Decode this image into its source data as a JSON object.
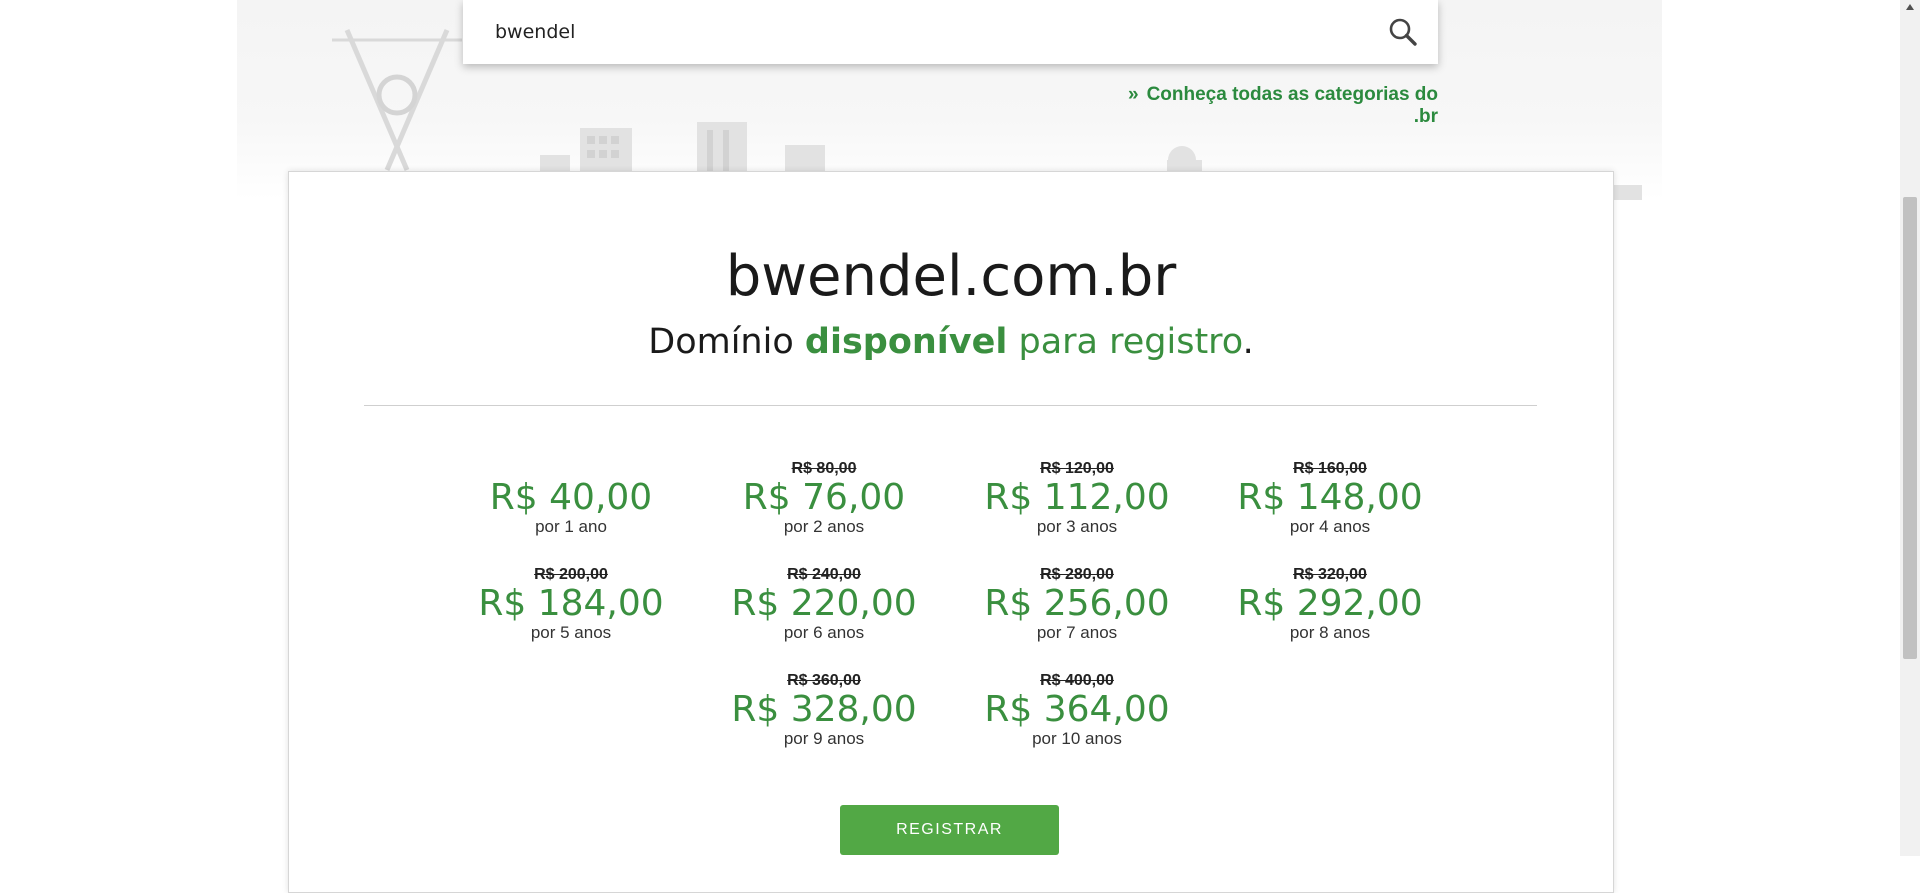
{
  "search": {
    "value": "bwendel"
  },
  "categories_link": {
    "text": "Conheça todas as categorias do .br"
  },
  "result": {
    "domain": "bwendel.com.br",
    "availability": {
      "prefix": "Domínio",
      "status": "disponível",
      "suffix": "para registro",
      "end": "."
    },
    "prices": [
      {
        "old": "",
        "new": "R$ 40,00",
        "period": "por 1 ano"
      },
      {
        "old": "R$ 80,00",
        "new": "R$ 76,00",
        "period": "por 2 anos"
      },
      {
        "old": "R$ 120,00",
        "new": "R$ 112,00",
        "period": "por 3 anos"
      },
      {
        "old": "R$ 160,00",
        "new": "R$ 148,00",
        "period": "por 4 anos"
      },
      {
        "old": "R$ 200,00",
        "new": "R$ 184,00",
        "period": "por 5 anos"
      },
      {
        "old": "R$ 240,00",
        "new": "R$ 220,00",
        "period": "por 6 anos"
      },
      {
        "old": "R$ 280,00",
        "new": "R$ 256,00",
        "period": "por 7 anos"
      },
      {
        "old": "R$ 320,00",
        "new": "R$ 292,00",
        "period": "por 8 anos"
      },
      {
        "old": "R$ 360,00",
        "new": "R$ 328,00",
        "period": "por 9 anos"
      },
      {
        "old": "R$ 400,00",
        "new": "R$ 364,00",
        "period": "por 10 anos"
      }
    ],
    "register_label": "REGISTRAR"
  },
  "colors": {
    "accent_green": "#3a8f3f",
    "button_green": "#52a845"
  }
}
